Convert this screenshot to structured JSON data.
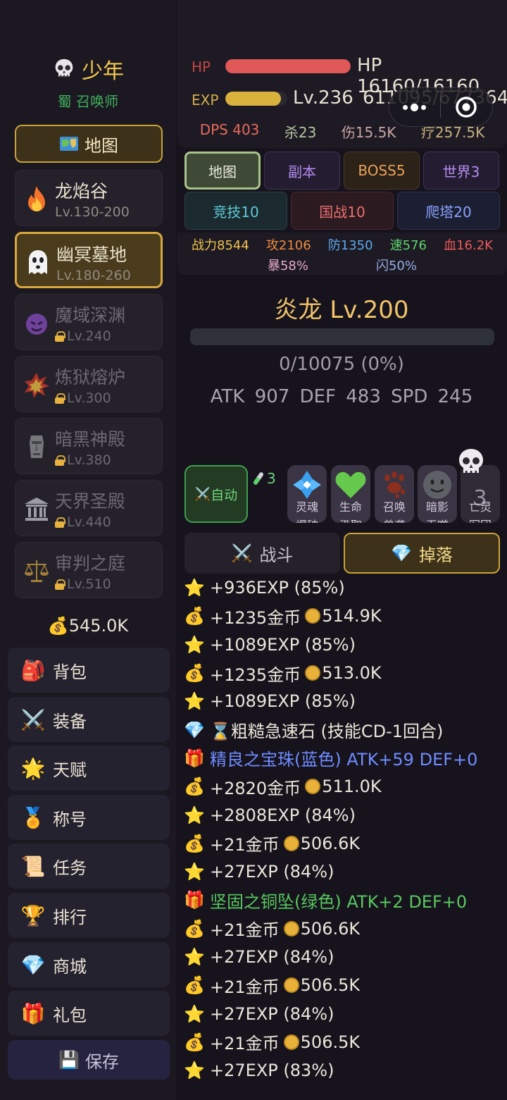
{
  "player": {
    "name": "少年",
    "class": "蜀 召唤师"
  },
  "sidebar": {
    "map_button": "地图",
    "zones": [
      {
        "name": "龙焰谷",
        "level": "Lv.130-200",
        "icon": "fire-icon",
        "locked": false
      },
      {
        "name": "幽冥墓地",
        "level": "Lv.180-260",
        "icon": "ghost-icon",
        "locked": false
      },
      {
        "name": "魔域深渊",
        "level": "Lv.240",
        "icon": "devil-icon",
        "locked": true
      },
      {
        "name": "炼狱熔炉",
        "level": "Lv.300",
        "icon": "explosion-icon",
        "locked": true
      },
      {
        "name": "暗黑神殿",
        "level": "Lv.380",
        "icon": "moai-icon",
        "locked": true
      },
      {
        "name": "天界圣殿",
        "level": "Lv.440",
        "icon": "temple-icon",
        "locked": true
      },
      {
        "name": "审判之庭",
        "level": "Lv.510",
        "icon": "scales-icon",
        "locked": true
      }
    ],
    "gold": "545.0K",
    "menu": [
      {
        "label": "背包",
        "icon": "backpack-icon"
      },
      {
        "label": "装备",
        "icon": "swords-icon"
      },
      {
        "label": "天赋",
        "icon": "sparkle-icon"
      },
      {
        "label": "称号",
        "icon": "medal-icon"
      },
      {
        "label": "任务",
        "icon": "scroll-icon"
      },
      {
        "label": "排行",
        "icon": "trophy-icon"
      },
      {
        "label": "商城",
        "icon": "diamond-icon"
      },
      {
        "label": "礼包",
        "icon": "gift-icon"
      }
    ],
    "save": "保存"
  },
  "status": {
    "hp_label": "HP",
    "hp_text": "HP 16160/16160",
    "hp_fraction": 1.0,
    "exp_label": "EXP",
    "level": "Lv.236",
    "exp_text": "611095/677364",
    "exp_fraction": 0.9,
    "dps": "DPS 403",
    "kills": "杀23",
    "damage": "伤15.5K",
    "heal": "疗257.5K"
  },
  "tabs": {
    "row1": [
      "地图",
      "副本",
      "BOSS5",
      "世界3"
    ],
    "row2": [
      "竞技10",
      "国战10",
      "爬塔20"
    ]
  },
  "power": {
    "combat": "战力8544",
    "atk": "攻2106",
    "def": "防1350",
    "spd": "速576",
    "hp": "血16.2K",
    "crit": "暴58%",
    "dodge": "闪50%"
  },
  "boss": {
    "name": "炎龙 Lv.200",
    "hp_text": "0/10075 (0%)",
    "hp_fraction": 0,
    "stats": "ATK 907  DEF 483  SPD 245"
  },
  "skills": {
    "auto_label": "自动",
    "potion_count": "3",
    "items": [
      {
        "name": "灵魂",
        "name2": "爆破",
        "cd": "",
        "icon": "soul-crystal-icon"
      },
      {
        "name": "生命",
        "name2": "汲取",
        "cd": "",
        "icon": "heart-icon"
      },
      {
        "name": "召唤",
        "name2": "兽袭",
        "cd": "",
        "icon": "paw-icon"
      },
      {
        "name": "暗影",
        "name2": "吞噬",
        "cd": "",
        "icon": "shadow-face-icon"
      },
      {
        "name": "亡灵",
        "name2": "军团",
        "cd": "3",
        "icon": "skull-icon"
      }
    ]
  },
  "log_tabs": {
    "battle": "战斗",
    "drops": "掉落"
  },
  "log": [
    {
      "icon": "star-icon",
      "text": "+936EXP (85%)",
      "color": "white"
    },
    {
      "icon": "money-bag-icon",
      "text": "+1235金币",
      "coin": "514.9K",
      "color": "white"
    },
    {
      "icon": "star-icon",
      "text": "+1089EXP (85%)",
      "color": "white"
    },
    {
      "icon": "money-bag-icon",
      "text": "+1235金币",
      "coin": "513.0K",
      "color": "white"
    },
    {
      "icon": "star-icon",
      "text": "+1089EXP (85%)",
      "color": "white"
    },
    {
      "icon": "diamond-icon",
      "text": "⌛粗糙急速石 (技能CD-1回合)",
      "color": "white"
    },
    {
      "icon": "gift-icon",
      "text": "精良之宝珠(蓝色) ATK+59 DEF+0",
      "color": "blue"
    },
    {
      "icon": "money-bag-icon",
      "text": "+2820金币",
      "coin": "511.0K",
      "color": "white"
    },
    {
      "icon": "star-icon",
      "text": "+2808EXP (84%)",
      "color": "white"
    },
    {
      "icon": "money-bag-icon",
      "text": "+21金币",
      "coin": "506.6K",
      "color": "white"
    },
    {
      "icon": "star-icon",
      "text": "+27EXP (84%)",
      "color": "white"
    },
    {
      "icon": "gift-icon",
      "text": "坚固之铜坠(绿色) ATK+2 DEF+0",
      "color": "green"
    },
    {
      "icon": "money-bag-icon",
      "text": "+21金币",
      "coin": "506.6K",
      "color": "white"
    },
    {
      "icon": "star-icon",
      "text": "+27EXP (84%)",
      "color": "white"
    },
    {
      "icon": "money-bag-icon",
      "text": "+21金币",
      "coin": "506.5K",
      "color": "white"
    },
    {
      "icon": "star-icon",
      "text": "+27EXP (84%)",
      "color": "white"
    },
    {
      "icon": "money-bag-icon",
      "text": "+21金币",
      "coin": "506.5K",
      "color": "white"
    },
    {
      "icon": "star-icon",
      "text": "+27EXP (83%)",
      "color": "white"
    }
  ],
  "colors": {
    "gold": "#f2c94c",
    "hp": "#e05858",
    "exp": "#d9b23e",
    "blue_item": "#6f8cff",
    "green_item": "#58c85e",
    "active_border": "#d9a93e"
  }
}
